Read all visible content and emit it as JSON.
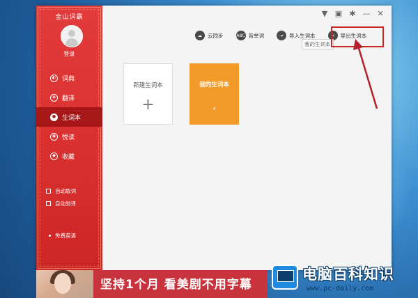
{
  "app": {
    "title": "金山词霸",
    "login": "登录"
  },
  "titlebar_icons": [
    {
      "name": "tshirt-icon",
      "glyph": "▼"
    },
    {
      "name": "chat-icon",
      "glyph": "▣"
    },
    {
      "name": "gear-icon",
      "glyph": "✱"
    },
    {
      "name": "minimize-icon",
      "glyph": "—"
    },
    {
      "name": "close-icon",
      "glyph": "✕"
    }
  ],
  "sidebar": {
    "items": [
      {
        "label": "词典",
        "icon": "dictionary-icon",
        "active": false
      },
      {
        "label": "翻译",
        "icon": "translate-icon",
        "active": false
      },
      {
        "label": "生词本",
        "icon": "vocab-book-icon",
        "active": true
      },
      {
        "label": "悦读",
        "icon": "reading-icon",
        "active": false
      },
      {
        "label": "收藏",
        "icon": "favorites-icon",
        "active": false
      }
    ],
    "options": [
      {
        "label": "自动取词"
      },
      {
        "label": "自动划译"
      }
    ],
    "footer_link": "免费英语"
  },
  "toolbar": {
    "items": [
      {
        "label": "云同步",
        "icon": "cloud-sync-icon",
        "glyph": "☁"
      },
      {
        "label": "背单词",
        "icon": "abc-icon",
        "glyph": "ABC"
      },
      {
        "label": "导入生词本",
        "icon": "import-icon",
        "glyph": "⇥"
      },
      {
        "label": "导出生词本",
        "icon": "export-icon",
        "glyph": "↪"
      }
    ],
    "tooltip": "我的生词本"
  },
  "cards": {
    "new_label": "新建生词本",
    "new_plus": "+",
    "mine_label": "我的生词本",
    "mine_count": "4"
  },
  "banner": {
    "text": "坚持1个月 看美剧不用字幕"
  },
  "watermark": {
    "title": "电脑百科知识",
    "url": "www.pc-daily.com"
  },
  "colors": {
    "sidebar_red": "#d92e2e",
    "active_red": "#a61818",
    "card_orange": "#f39b29",
    "highlight_red": "#c62828"
  }
}
